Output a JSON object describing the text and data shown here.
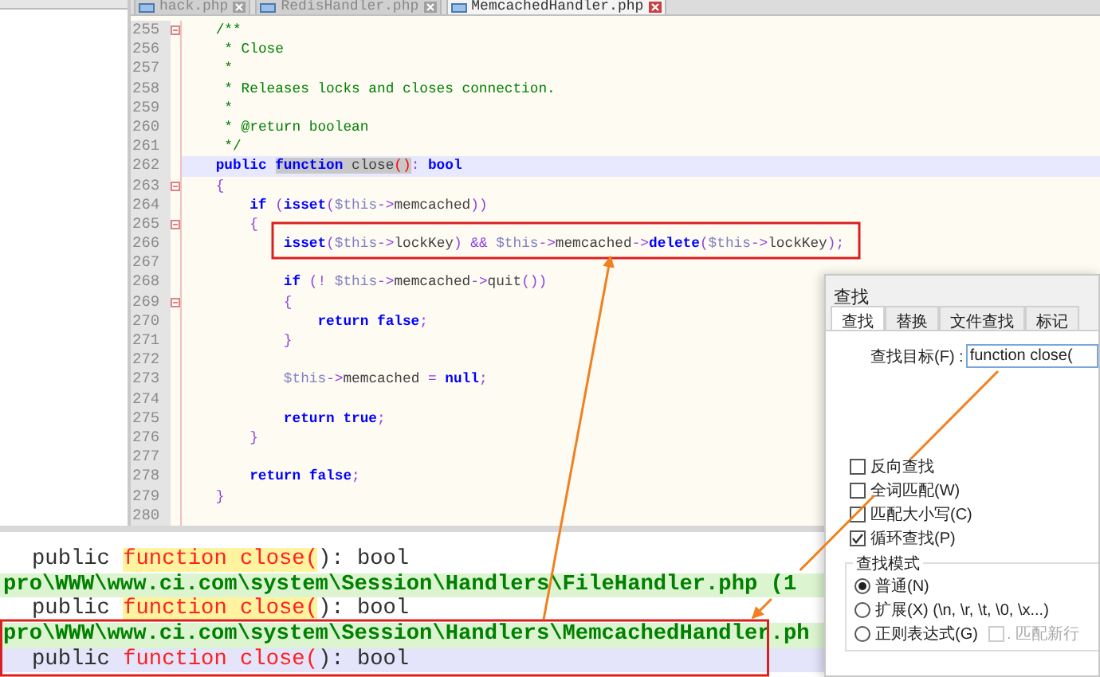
{
  "editor_tabs": [
    {
      "label": "hack.php",
      "selected": false
    },
    {
      "label": "RedisHandler.php",
      "selected": false
    },
    {
      "label": "MemcachedHandler.php",
      "selected": true
    }
  ],
  "editor": {
    "lines": [
      {
        "number": "255",
        "fold": true,
        "current": false,
        "tokens": [
          {
            "kind": "comment",
            "text": "    /**"
          }
        ]
      },
      {
        "number": "256",
        "fold": false,
        "current": false,
        "tokens": [
          {
            "kind": "comment",
            "text": "     * Close"
          }
        ]
      },
      {
        "number": "257",
        "fold": false,
        "current": false,
        "tokens": [
          {
            "kind": "comment",
            "text": "     *"
          }
        ]
      },
      {
        "number": "258",
        "fold": false,
        "current": false,
        "tokens": [
          {
            "kind": "comment",
            "text": "     * Releases locks and closes connection."
          }
        ]
      },
      {
        "number": "259",
        "fold": false,
        "current": false,
        "tokens": [
          {
            "kind": "comment",
            "text": "     *"
          }
        ]
      },
      {
        "number": "260",
        "fold": false,
        "current": false,
        "tokens": [
          {
            "kind": "comment",
            "text": "     * @return boolean"
          }
        ]
      },
      {
        "number": "261",
        "fold": false,
        "current": false,
        "tokens": [
          {
            "kind": "comment",
            "text": "     */"
          }
        ]
      },
      {
        "number": "262",
        "fold": false,
        "current": true,
        "tokens": [
          {
            "kind": "keyword",
            "text": "    public "
          },
          {
            "kind": "hl-keyword",
            "text": "function"
          },
          {
            "kind": "hl-plain",
            "text": " close"
          },
          {
            "kind": "brace",
            "text": "()"
          },
          {
            "kind": "operator",
            "text": ": "
          },
          {
            "kind": "keyword",
            "text": "bool"
          }
        ]
      },
      {
        "number": "263",
        "fold": true,
        "current": false,
        "tokens": [
          {
            "kind": "operator",
            "text": "    {"
          }
        ]
      },
      {
        "number": "264",
        "fold": false,
        "current": false,
        "tokens": [
          {
            "kind": "keyword",
            "text": "        if "
          },
          {
            "kind": "operator",
            "text": "("
          },
          {
            "kind": "keyword",
            "text": "isset"
          },
          {
            "kind": "operator",
            "text": "("
          },
          {
            "kind": "variable",
            "text": "$this"
          },
          {
            "kind": "operator",
            "text": "->"
          },
          {
            "kind": "plain",
            "text": "memcached"
          },
          {
            "kind": "operator",
            "text": "))"
          }
        ]
      },
      {
        "number": "265",
        "fold": true,
        "current": false,
        "tokens": [
          {
            "kind": "operator",
            "text": "        {"
          }
        ]
      },
      {
        "number": "266",
        "fold": false,
        "current": false,
        "tokens": [
          {
            "kind": "keyword",
            "text": "            isset"
          },
          {
            "kind": "operator",
            "text": "("
          },
          {
            "kind": "variable",
            "text": "$this"
          },
          {
            "kind": "operator",
            "text": "->"
          },
          {
            "kind": "plain",
            "text": "lockKey"
          },
          {
            "kind": "operator",
            "text": ") && "
          },
          {
            "kind": "variable",
            "text": "$this"
          },
          {
            "kind": "operator",
            "text": "->"
          },
          {
            "kind": "plain",
            "text": "memcached"
          },
          {
            "kind": "operator",
            "text": "->"
          },
          {
            "kind": "keyword",
            "text": "delete"
          },
          {
            "kind": "operator",
            "text": "("
          },
          {
            "kind": "variable",
            "text": "$this"
          },
          {
            "kind": "operator",
            "text": "->"
          },
          {
            "kind": "plain",
            "text": "lockKey"
          },
          {
            "kind": "operator",
            "text": ");"
          }
        ]
      },
      {
        "number": "267",
        "fold": false,
        "current": false
      },
      {
        "number": "268",
        "fold": false,
        "current": false,
        "tokens": [
          {
            "kind": "keyword",
            "text": "            if "
          },
          {
            "kind": "operator",
            "text": "(! "
          },
          {
            "kind": "variable",
            "text": "$this"
          },
          {
            "kind": "operator",
            "text": "->"
          },
          {
            "kind": "plain",
            "text": "memcached"
          },
          {
            "kind": "operator",
            "text": "->"
          },
          {
            "kind": "plain",
            "text": "quit"
          },
          {
            "kind": "operator",
            "text": "())"
          }
        ]
      },
      {
        "number": "269",
        "fold": true,
        "current": false,
        "tokens": [
          {
            "kind": "operator",
            "text": "            {"
          }
        ]
      },
      {
        "number": "270",
        "fold": false,
        "current": false,
        "tokens": [
          {
            "kind": "keyword",
            "text": "                return false"
          },
          {
            "kind": "operator",
            "text": ";"
          }
        ]
      },
      {
        "number": "271",
        "fold": false,
        "current": false,
        "tokens": [
          {
            "kind": "operator",
            "text": "            }"
          }
        ]
      },
      {
        "number": "272",
        "fold": false,
        "current": false
      },
      {
        "number": "273",
        "fold": false,
        "current": false,
        "tokens": [
          {
            "kind": "variable",
            "text": "            $this"
          },
          {
            "kind": "operator",
            "text": "->"
          },
          {
            "kind": "plain",
            "text": "memcached "
          },
          {
            "kind": "operator",
            "text": "= "
          },
          {
            "kind": "keyword",
            "text": "null"
          },
          {
            "kind": "operator",
            "text": ";"
          }
        ]
      },
      {
        "number": "274",
        "fold": false,
        "current": false
      },
      {
        "number": "275",
        "fold": false,
        "current": false,
        "tokens": [
          {
            "kind": "keyword",
            "text": "            return true"
          },
          {
            "kind": "operator",
            "text": ";"
          }
        ]
      },
      {
        "number": "276",
        "fold": false,
        "current": false,
        "tokens": [
          {
            "kind": "operator",
            "text": "        }"
          }
        ]
      },
      {
        "number": "277",
        "fold": false,
        "current": false
      },
      {
        "number": "278",
        "fold": false,
        "current": false,
        "tokens": [
          {
            "kind": "keyword",
            "text": "        return false"
          },
          {
            "kind": "operator",
            "text": ";"
          }
        ]
      },
      {
        "number": "279",
        "fold": false,
        "current": false,
        "tokens": [
          {
            "kind": "operator",
            "text": "    }"
          }
        ]
      },
      {
        "number": "280",
        "fold": false,
        "current": false
      }
    ]
  },
  "search_results": [
    {
      "kind": "hit",
      "selected": false,
      "prefix": "public ",
      "match": "function close(",
      "suffix": "): bool"
    },
    {
      "kind": "file",
      "selected": false,
      "path": "pro\\WWW\\www.ci.com\\system\\Session\\Handlers\\FileHandler.php (1"
    },
    {
      "kind": "hit",
      "selected": false,
      "prefix": "public ",
      "match": "function close(",
      "suffix": "): bool"
    },
    {
      "kind": "file",
      "selected": false,
      "path": "pro\\WWW\\www.ci.com\\system\\Session\\Handlers\\MemcachedHandler.ph"
    },
    {
      "kind": "hit",
      "selected": true,
      "prefix": "public ",
      "match": "function close(",
      "suffix": "): bool"
    }
  ],
  "find_dialog": {
    "title": "查找",
    "tabs": [
      {
        "label": "查找",
        "selected": true
      },
      {
        "label": "替换",
        "selected": false
      },
      {
        "label": "文件查找",
        "selected": false
      },
      {
        "label": "标记",
        "selected": false
      }
    ],
    "target_label": "查找目标(F) :",
    "target_value": "function close(",
    "options": [
      {
        "label": "反向查找",
        "checked": false
      },
      {
        "label": "全词匹配(W)",
        "checked": false
      },
      {
        "label": "匹配大小写(C)",
        "checked": false
      },
      {
        "label": "循环查找(P)",
        "checked": true
      }
    ],
    "mode_title": "查找模式",
    "modes": [
      {
        "label": "普通(N)",
        "selected": true
      },
      {
        "label": "扩展(X) (\\n, \\r, \\t, \\0, \\x...)",
        "selected": false
      },
      {
        "label": "正则表达式(G)",
        "selected": false
      }
    ],
    "newline_option": {
      "label": ". 匹配新行",
      "checked": false,
      "disabled": true
    }
  }
}
